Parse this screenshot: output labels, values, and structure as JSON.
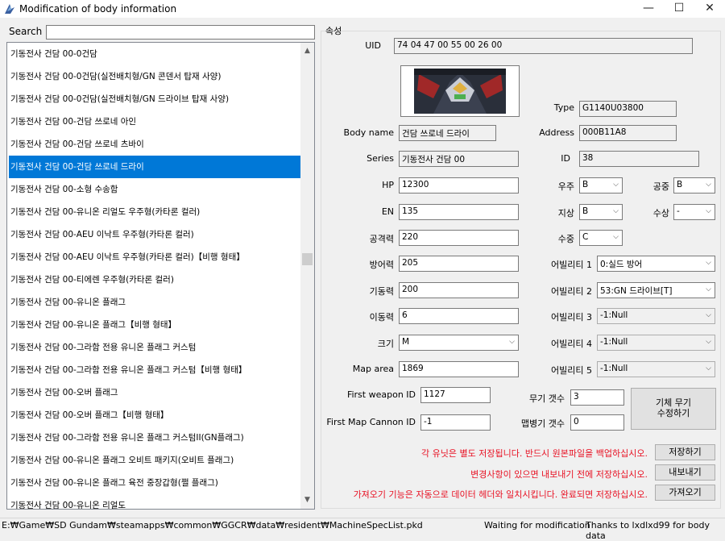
{
  "window": {
    "title": "Modification of body information",
    "minimize": "—",
    "maximize": "☐",
    "close": "✕"
  },
  "search": {
    "label": "Search",
    "value": ""
  },
  "list": {
    "items": [
      "기동전사 건담 00-0건담",
      "기동전사 건담 00-0건담(실전배치형/GN 콘덴서 탑재 사양)",
      "기동전사 건담 00-0건담(실전배치형/GN 드라이브 탑재 사양)",
      "기동전사 건담 00-건담 쓰로네 아인",
      "기동전사 건담 00-건담 쓰로네 츠바이",
      "기동전사 건담 00-건담 쓰로네 드라이",
      "기동전사 건담 00-소형 수송함",
      "기동전사 건담 00-유니온 리얼도 우주형(카타론 컬러)",
      "기동전사 건담 00-AEU 이낙트 우주형(카타론 컬러)",
      "기동전사 건담 00-AEU 이낙트 우주형(카타론 컬러)【비행 형태】",
      "기동전사 건담 00-티에렌 우주형(카타론 컬러)",
      "기동전사 건담 00-유니온 플래그",
      "기동전사 건담 00-유니온 플래그【비행 형태】",
      "기동전사 건담 00-그라함 전용 유니온 플래그 커스텀",
      "기동전사 건담 00-그라함 전용 유니온 플래그 커스텀【비행 형태】",
      "기동전사 건담 00-오버 플래그",
      "기동전사 건담 00-오버 플래그【비행 형태】",
      "기동전사 건담 00-그라함 전용 유니온 플래그 커스텀II(GN플래그)",
      "기동전사 건담 00-유니온 플래그 오비트 패키지(오비트 플래그)",
      "기동전사 건담 00-유니온 플래그 육전 중장갑형(쩔 플래그)",
      "기동전사 건담 00-유니온 리얼도"
    ],
    "selected_index": 5
  },
  "props": {
    "group_label": "속성",
    "uid_label": "UID",
    "uid": "74 04 47 00 55 00 26 00",
    "type_label": "Type",
    "type": "G1140U03800",
    "body_name_label": "Body name",
    "body_name": "건담 쓰로네 드라이",
    "address_label": "Address",
    "address": "000B11A8",
    "series_label": "Series",
    "series": "기동전사 건담 00",
    "id_label": "ID",
    "id": "38",
    "hp_label": "HP",
    "hp": "12300",
    "en_label": "EN",
    "en": "135",
    "attack_label": "공격력",
    "attack": "220",
    "defense_label": "방어력",
    "defense": "205",
    "mobility_label": "기동력",
    "mobility": "200",
    "movement_label": "이동력",
    "movement": "6",
    "size_label": "크기",
    "size": "M",
    "map_area_label": "Map area",
    "map_area": "1869",
    "first_weapon_label": "First weapon ID",
    "first_weapon": "1127",
    "first_cannon_label": "First Map Cannon ID",
    "first_cannon": "-1",
    "space_label": "우주",
    "space": "B",
    "air_label": "공중",
    "air": "B",
    "ground_label": "지상",
    "ground": "B",
    "water_label": "수상",
    "water": "-",
    "underwater_label": "수중",
    "underwater": "C",
    "ability1_label": "어빌리티 1",
    "ability1": "0:실드 방어",
    "ability2_label": "어빌리티 2",
    "ability2": "53:GN 드라이브[T]",
    "ability3_label": "어빌리티 3",
    "ability3": "-1:Null",
    "ability4_label": "어빌리티 4",
    "ability4": "-1:Null",
    "ability5_label": "어빌리티 5",
    "ability5": "-1:Null",
    "weapon_count_label": "무기 갯수",
    "weapon_count": "3",
    "cannon_count_label": "맵병기 갯수",
    "cannon_count": "0",
    "edit_weapon_button_line1": "기체 무기",
    "edit_weapon_button_line2": "수정하기"
  },
  "actions": {
    "warn1": "각 유닛은 별도 저장됩니다. 반드시 원본파일을 백업하십시오.",
    "save": "저장하기",
    "warn2": "변경사항이 있으면 내보내기 전에 저장하십시오.",
    "export": "내보내기",
    "warn3": "가져오기 기능은 자동으로 데이터 헤더와 일치시킵니다. 완료되면 저장하십시오.",
    "import": "가져오기"
  },
  "status": {
    "path": "E:₩Game₩SD Gundam₩steamapps₩common₩GGCR₩data₩resident₩MachineSpecList.pkd",
    "state": "Waiting for modification",
    "credit": "Thanks to lxdlxd99 for body data"
  },
  "colors": {
    "selection": "#0078d7",
    "warning": "#e81123"
  }
}
